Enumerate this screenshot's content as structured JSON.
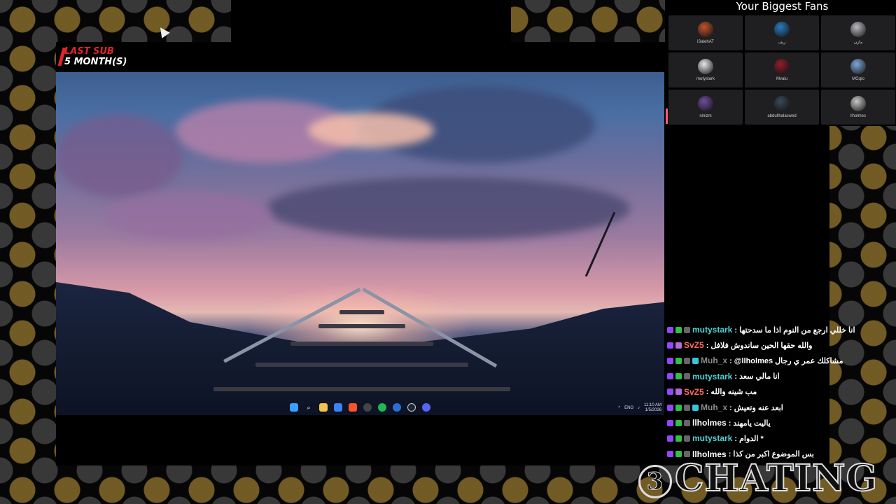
{
  "last_sub": {
    "line1": "LAST SUB",
    "line2": "5 MONTH(S)"
  },
  "fans": {
    "title": "Your Biggest Fans",
    "items": [
      {
        "name": "iSalehAT",
        "color": "#c0522a"
      },
      {
        "name": "زيف",
        "color": "#2b7bbd"
      },
      {
        "name": "مازن",
        "color": "#b9b9c0"
      },
      {
        "name": "mutystark",
        "color": "#e8e8e8"
      },
      {
        "name": "Mvalu",
        "color": "#8e1f2c"
      },
      {
        "name": "MGqio",
        "color": "#7fa7d8"
      },
      {
        "name": "ninizm",
        "color": "#6d4e9c"
      },
      {
        "name": "abdullhalaswed",
        "color": "#3a4a5a"
      },
      {
        "name": "llholmes",
        "color": "#c8c8c8"
      }
    ]
  },
  "chat": [
    {
      "user": "mutystark",
      "color": "#4fd3d6",
      "text": ": انا خللي ارجع من النوم اذا ما سدحتها",
      "badges": [
        "purple",
        "green",
        "grey"
      ]
    },
    {
      "user": "SvZ5",
      "color": "#ff6b5e",
      "text": ": والله حقها الحين ساندوش فلافل",
      "badges": [
        "purple",
        "gift"
      ]
    },
    {
      "user": "Muh_x",
      "color": "#8a8a8a",
      "text": ": @llholmes مشاكلك عمر ي رجال",
      "badges": [
        "purple",
        "green",
        "grey",
        "cyan"
      ]
    },
    {
      "user": "mutystark",
      "color": "#4fd3d6",
      "text": ": انا مالي سعد",
      "badges": [
        "purple",
        "green",
        "grey"
      ]
    },
    {
      "user": "SvZ5",
      "color": "#ff6b5e",
      "text": ": مب شينه والله",
      "badges": [
        "purple",
        "gift"
      ]
    },
    {
      "user": "Muh_x",
      "color": "#8a8a8a",
      "text": ": ابعد عنه وتعيش",
      "badges": [
        "purple",
        "green",
        "grey",
        "cyan"
      ]
    },
    {
      "user": "llholmes",
      "color": "#ffffff",
      "text": ": ياليت يامهند",
      "badges": [
        "purple",
        "green",
        "grey"
      ]
    },
    {
      "user": "mutystark",
      "color": "#4fd3d6",
      "text": ": الدوام *",
      "badges": [
        "purple",
        "green",
        "grey"
      ]
    },
    {
      "user": "llholmes",
      "color": "#ffffff",
      "text": ": بس الموضوع اكبر من كذا",
      "badges": [
        "purple",
        "green",
        "grey"
      ]
    }
  ],
  "taskbar": {
    "icons": [
      "windows-icon",
      "search-icon",
      "folder-icon",
      "store-icon",
      "brave-icon",
      "clock-icon",
      "spotify-icon",
      "refresh-icon",
      "steam-icon",
      "discord-icon"
    ],
    "language": "ENG",
    "time": "11:10 AM",
    "date": "1/5/2026"
  },
  "overlay_logo": {
    "number": "3",
    "text": "CHATING"
  }
}
